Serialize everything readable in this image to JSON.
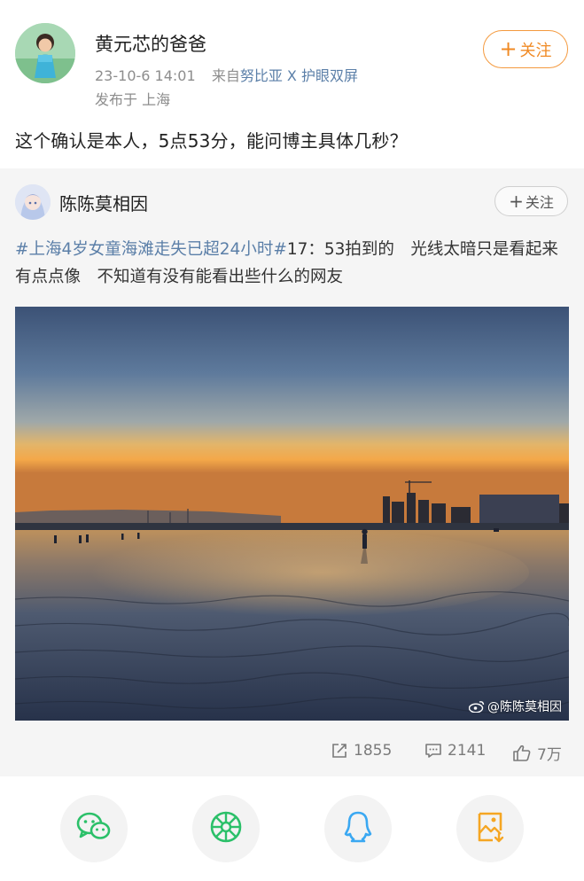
{
  "post": {
    "author": "黄元芯的爸爸",
    "date": "23-10-6 14:01",
    "source_prefix": "来自",
    "source_device": "努比亚 X 护眼双屏",
    "location": "发布于 上海",
    "follow_label": "关注",
    "text": "这个确认是本人，5点53分，能问博主具体几秒？"
  },
  "repost": {
    "author": "陈陈莫相因",
    "follow_label": "关注",
    "hashtag": "#上海4岁女童海滩走失已超24小时#",
    "text_rest": "17：53拍到的　光线太暗只是看起来有点点像　不知道有没有能看出些什么的网友",
    "watermark": "@陈陈莫相因",
    "stats": {
      "reposts": "1855",
      "comments": "2141",
      "likes": "7万"
    }
  },
  "share": {
    "icons": [
      "wechat-icon",
      "moments-icon",
      "qq-icon",
      "save-image-icon"
    ]
  },
  "colors": {
    "accent_orange": "#f08a24",
    "link_blue": "#5b7fa8",
    "wechat_green": "#2bc069",
    "qq_blue": "#3aa8f2",
    "save_orange": "#f5a623"
  }
}
